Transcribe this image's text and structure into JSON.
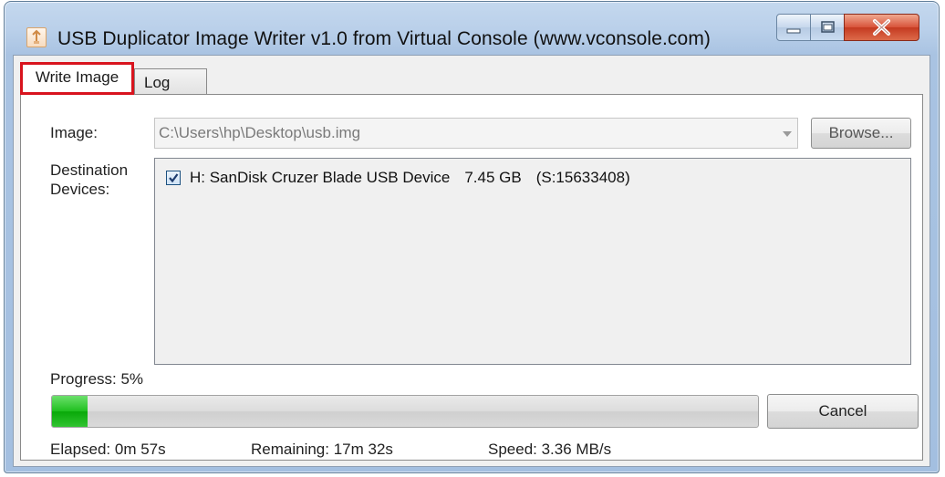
{
  "window": {
    "title": "USB Duplicator Image Writer v1.0 from Virtual Console (www.vconsole.com)",
    "icons": [
      "app-icon",
      "minimize-icon",
      "maximize-icon",
      "close-icon"
    ]
  },
  "tabs": [
    {
      "label": "Write Image",
      "active": true
    },
    {
      "label": "Log",
      "active": false
    }
  ],
  "image": {
    "label": "Image:",
    "value": "C:\\Users\\hp\\Desktop\\usb.img",
    "browse_label": "Browse..."
  },
  "destination": {
    "label_line1": "Destination",
    "label_line2": "Devices:",
    "devices": [
      {
        "checked": true,
        "name": "H: SanDisk Cruzer Blade USB Device",
        "size": "7.45 GB",
        "serial": "(S:15633408)"
      }
    ]
  },
  "progress": {
    "label": "Progress: 5%",
    "value": 0.05,
    "cancel_label": "Cancel",
    "elapsed": "Elapsed: 0m 57s",
    "remaining": "Remaining: 17m 32s",
    "speed": "Speed: 3.36 MB/s"
  },
  "colors": {
    "highlight": "#d8141e",
    "progress_fill": "#1fbf1f"
  }
}
